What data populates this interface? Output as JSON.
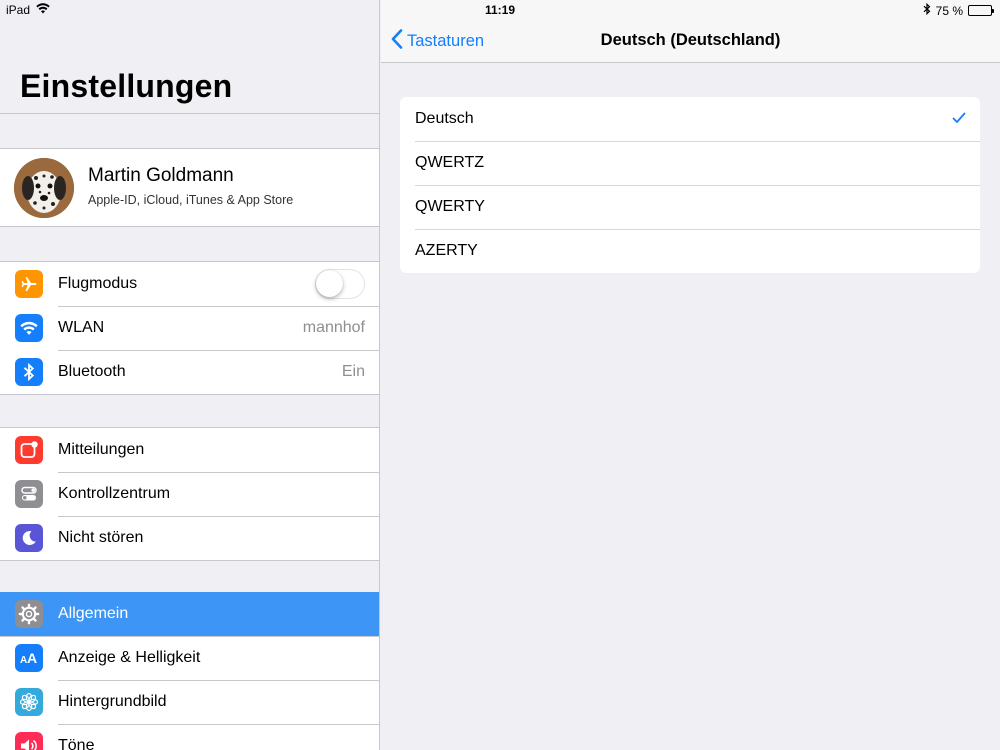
{
  "status_bar": {
    "device": "iPad",
    "time": "11:19",
    "battery": "75 %",
    "battery_level": 0.75
  },
  "sidebar": {
    "title": "Einstellungen",
    "profile": {
      "name": "Martin Goldmann",
      "subtitle": "Apple-ID, iCloud, iTunes & App Store"
    },
    "groups": [
      {
        "items": [
          {
            "label": "Flugmodus",
            "icon": "airplane-icon",
            "icon_color": "#ff9500",
            "toggle_on": false
          },
          {
            "label": "WLAN",
            "icon": "wifi-icon",
            "icon_color": "#147efb",
            "value": "mannhof"
          },
          {
            "label": "Bluetooth",
            "icon": "bluetooth-icon",
            "icon_color": "#147efb",
            "value": "Ein"
          }
        ]
      },
      {
        "items": [
          {
            "label": "Mitteilungen",
            "icon": "notifications-icon",
            "icon_color": "#ff3b30"
          },
          {
            "label": "Kontrollzentrum",
            "icon": "control-center-icon",
            "icon_color": "#8e8e93"
          },
          {
            "label": "Nicht stören",
            "icon": "moon-icon",
            "icon_color": "#5856d6"
          }
        ]
      },
      {
        "items": [
          {
            "label": "Allgemein",
            "icon": "gear-icon",
            "icon_color": "#8e8e93",
            "selected": true
          },
          {
            "label": "Anzeige & Helligkeit",
            "icon": "text-size-icon",
            "icon_color": "#147efb"
          },
          {
            "label": "Hintergrundbild",
            "icon": "flower-icon",
            "icon_color": "#34aadc"
          },
          {
            "label": "Töne",
            "icon": "speaker-icon",
            "icon_color": "#ff2d55"
          }
        ]
      }
    ]
  },
  "detail": {
    "back_label": "Tastaturen",
    "title": "Deutsch (Deutschland)",
    "options": [
      {
        "label": "Deutsch",
        "checked": true
      },
      {
        "label": "QWERTZ",
        "checked": false
      },
      {
        "label": "QWERTY",
        "checked": false
      },
      {
        "label": "AZERTY",
        "checked": false
      }
    ],
    "accent_color": "#147efb"
  }
}
